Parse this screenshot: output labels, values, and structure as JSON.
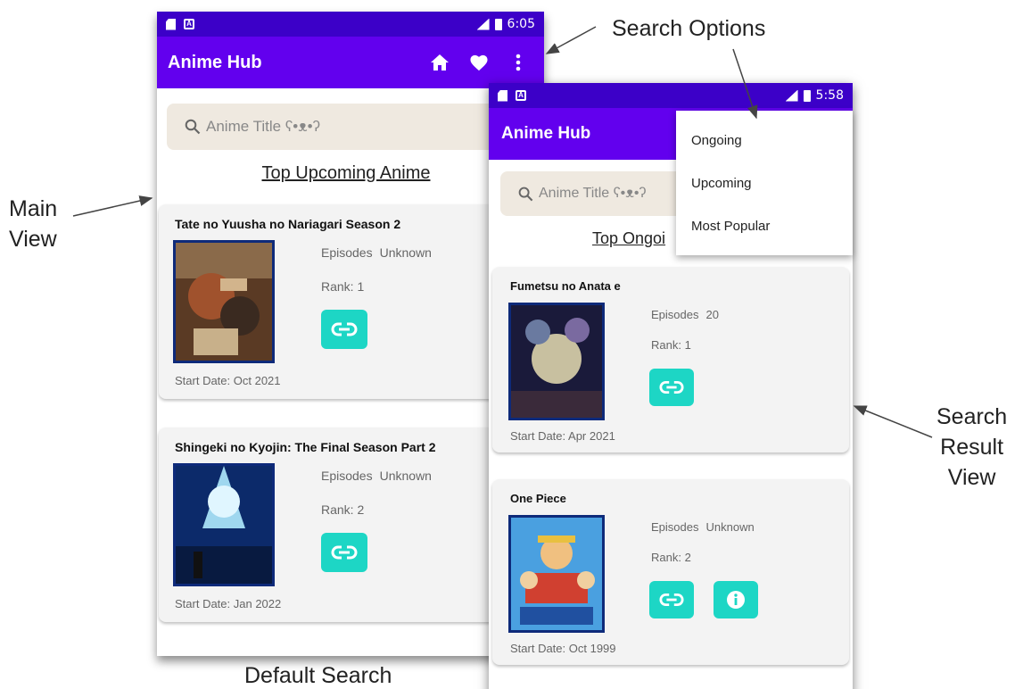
{
  "annotations": {
    "main_view": [
      "Main",
      "View"
    ],
    "search_options": "Search Options",
    "search_result_view": [
      "Search",
      "Result",
      "View"
    ],
    "default_search": "Default Search"
  },
  "main_phone": {
    "status_time": "6:05",
    "app_title": "Anime Hub",
    "search_placeholder": "Anime Title ʕ•ᴥ•ʔ",
    "section_title": "Top Upcoming Anime",
    "cards": [
      {
        "title": "Tate no Yuusha no Nariagari Season 2",
        "episodes_label": "Episodes",
        "episodes": "Unknown",
        "rank": "Rank: 1",
        "start_date": "Start Date: Oct 2021"
      },
      {
        "title": "Shingeki no Kyojin: The Final Season Part 2",
        "episodes_label": "Episodes",
        "episodes": "Unknown",
        "rank": "Rank: 2",
        "start_date": "Start Date: Jan 2022"
      }
    ]
  },
  "search_phone": {
    "status_time": "5:58",
    "app_title": "Anime Hub",
    "search_placeholder": "Anime Title ʕ•ᴥ•ʔ",
    "section_title": "Top Ongoi",
    "menu_items": [
      "Ongoing",
      "Upcoming",
      "Most Popular"
    ],
    "cards": [
      {
        "title": "Fumetsu no Anata e",
        "episodes_label": "Episodes",
        "episodes": "20",
        "rank": "Rank: 1",
        "start_date": "Start Date: Apr 2021"
      },
      {
        "title": "One Piece",
        "episodes_label": "Episodes",
        "episodes": "Unknown",
        "rank": "Rank: 2",
        "start_date": "Start Date: Oct 1999"
      }
    ]
  },
  "colors": {
    "status_bar": "#3c00c8",
    "app_bar": "#6200ee",
    "button": "#1dd6c5",
    "search_field": "#efe9e0"
  },
  "icons": [
    "home-icon",
    "heart-icon",
    "more-vert-icon",
    "search-icon",
    "link-icon",
    "info-icon"
  ]
}
